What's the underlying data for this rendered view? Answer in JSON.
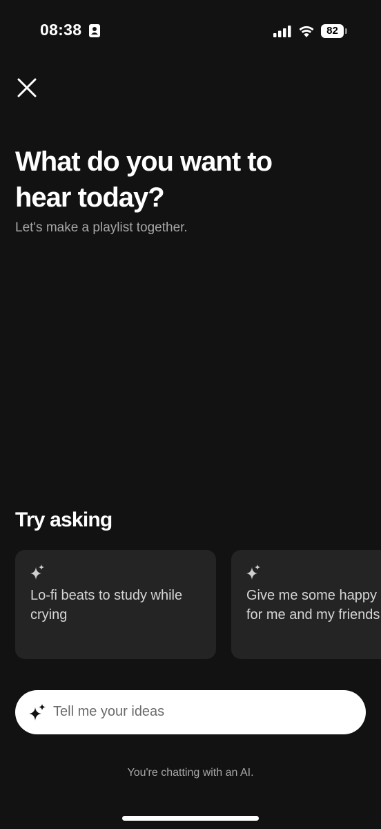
{
  "status_bar": {
    "time": "08:38",
    "battery_level": "82",
    "icons": [
      "contact-card-icon",
      "cellular-signal-icon",
      "wifi-icon",
      "battery-icon"
    ]
  },
  "header": {
    "close_icon": "close-icon"
  },
  "main": {
    "title": "What do you want to hear today?",
    "subtitle": "Let's make a playlist together."
  },
  "suggestions": {
    "title": "Try asking",
    "items": [
      {
        "text": "Lo-fi beats to study while crying",
        "icon": "sparkle-icon"
      },
      {
        "text": "Give me some happy songs for me and my friends",
        "icon": "sparkle-icon"
      }
    ]
  },
  "prompt": {
    "placeholder": "Tell me your ideas",
    "icon": "sparkle-icon"
  },
  "footer": {
    "disclaimer": "You're chatting with an AI."
  },
  "colors": {
    "background": "#121212",
    "card": "#242424",
    "input": "#ffffff",
    "subtle_text": "#a7a7a7"
  }
}
